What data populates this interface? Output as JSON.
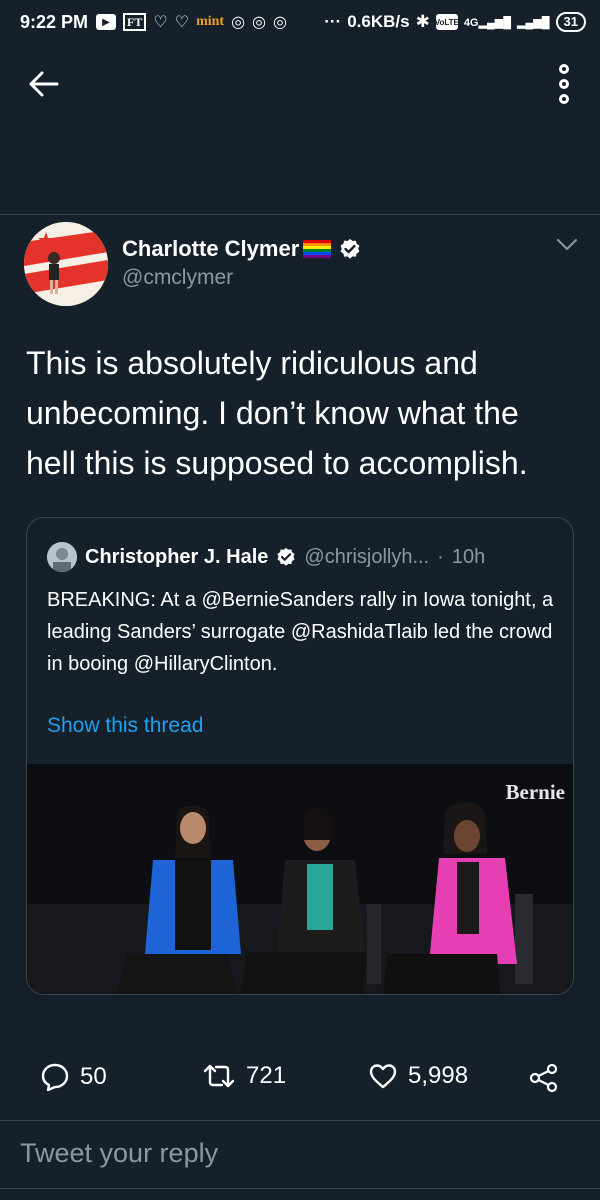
{
  "status_bar": {
    "time": "9:22 PM",
    "ft": "FT",
    "mint": "mint",
    "net_speed": "0.6KB/s",
    "volte": "VoLTE",
    "network": "4G",
    "battery": "31",
    "dots": "···"
  },
  "nav": {
    "back_icon": "arrow-left-icon",
    "more_icon": "more-vertical-icon"
  },
  "tweet": {
    "author_name": "Charlotte Clymer",
    "author_handle": "@cmclymer",
    "text": "This is absolutely ridiculous and unbecoming. I don’t know what the hell this is supposed to accomplish.",
    "verified": true
  },
  "quote": {
    "author_name": "Christopher J. Hale",
    "author_handle": "@chrisjollyh...",
    "separator": "·",
    "time": "10h",
    "text": "BREAKING: At a @BernieSanders rally in Iowa tonight, a leading Sanders’ surrogate @RashidaTlaib led the crowd in booing @HillaryClinton.",
    "show_thread": "Show this thread",
    "media_watermark": "Bernie"
  },
  "actions": {
    "replies": "50",
    "retweets": "721",
    "likes": "5,998"
  },
  "reply_box": {
    "placeholder": "Tweet your reply"
  },
  "colors": {
    "background": "#15202b",
    "divider": "#38444d",
    "secondary_text": "#8899a6",
    "link": "#1da1f2"
  }
}
